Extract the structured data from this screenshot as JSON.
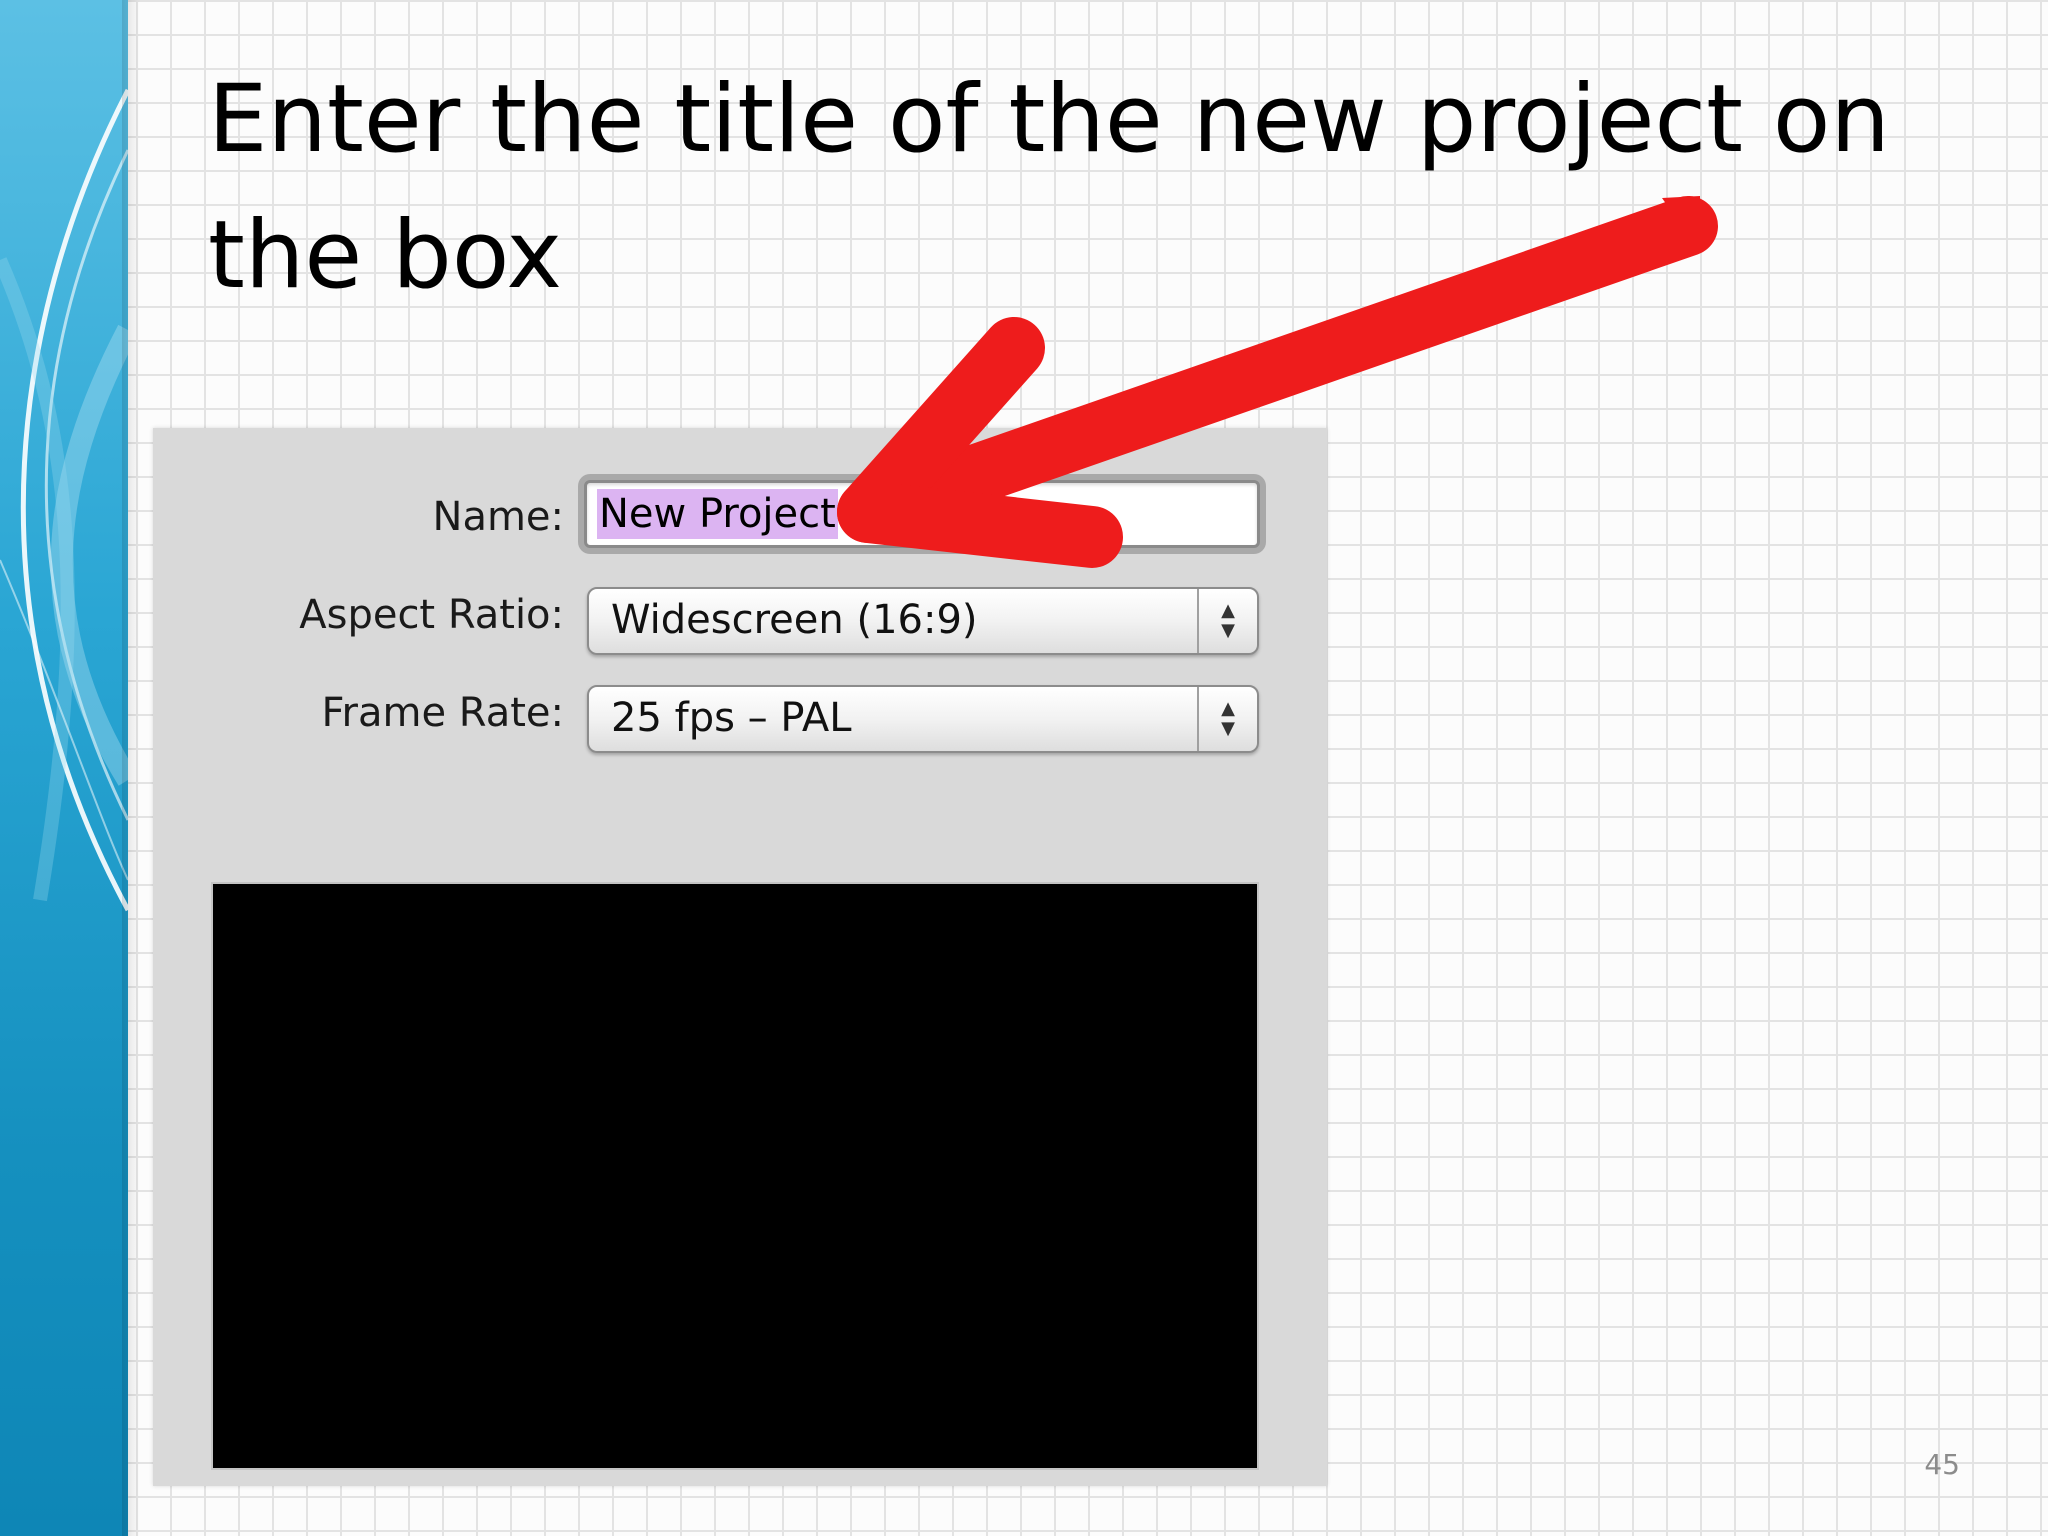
{
  "slide": {
    "title": "Enter the title of the new project on the box",
    "page_number": "45"
  },
  "dialog": {
    "name_label": "Name:",
    "name_value": "New Project",
    "aspect_label": "Aspect Ratio:",
    "aspect_value": "Widescreen (16:9)",
    "frame_label": "Frame Rate:",
    "frame_value": "25 fps – PAL"
  },
  "colors": {
    "arrow": "#ee1c1c",
    "selection": "#dcb4f2",
    "band": "#2aa6d4"
  },
  "icons": {
    "popup_stepper": "up-down-arrows-icon",
    "pointer": "red-arrow-icon"
  }
}
